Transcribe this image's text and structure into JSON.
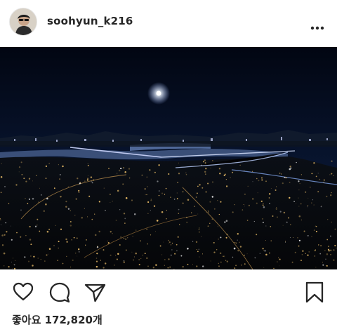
{
  "post": {
    "username": "soohyun_k216",
    "likes_label": "좋아요 172,820개"
  },
  "icons": {
    "more": "more-horizontal-icon",
    "like": "heart-icon",
    "comment": "comment-icon",
    "share": "send-icon",
    "save": "bookmark-icon"
  },
  "colors": {
    "text": "#262626",
    "sky_top": "#020612",
    "sky_bottom": "#0f1f40",
    "city_lights": "#f3c46b",
    "river": "#6d86b4"
  }
}
